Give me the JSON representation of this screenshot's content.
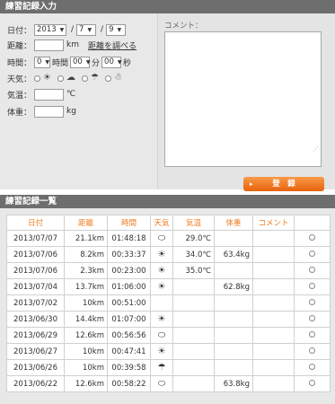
{
  "form": {
    "title": "練習記録入力",
    "date": {
      "label": "日付：",
      "year": "2013",
      "month": "7",
      "day": "9",
      "sep": "/"
    },
    "distance": {
      "label": "距離：",
      "value": "",
      "unit": "km",
      "lookup_link": "距離を調べる"
    },
    "time": {
      "label": "時間：",
      "hours": "0",
      "hours_unit": "時間",
      "minutes": "00",
      "minutes_unit": "分",
      "seconds": "00",
      "seconds_unit": "秒"
    },
    "weather": {
      "label": "天気：",
      "options": [
        "sunny-icon",
        "cloudy-icon",
        "rain-icon",
        "snowman-icon"
      ],
      "glyphs": [
        "☀",
        "☁",
        "☂",
        "☃"
      ]
    },
    "temperature": {
      "label": "気温：",
      "value": "",
      "unit": "℃"
    },
    "weight": {
      "label": "体重：",
      "value": "",
      "unit": "kg"
    },
    "comment": {
      "label": "コメント：",
      "value": ""
    },
    "submit_label": "登　録",
    "select_arrow": "▼",
    "grip": "⋰",
    "bullet": "▸"
  },
  "list": {
    "title": "練習記録一覧",
    "columns": [
      "日付",
      "距離",
      "時間",
      "天気",
      "気温",
      "体重",
      "コメント"
    ],
    "rows": [
      {
        "date": "2013/07/07",
        "distance": "21.1km",
        "time": "01:48:18",
        "weather": "cloudy",
        "glyph": "⬭",
        "temp": "29.0℃",
        "weight": "",
        "comment": ""
      },
      {
        "date": "2013/07/06",
        "distance": "8.2km",
        "time": "00:33:37",
        "weather": "sunny",
        "glyph": "☀",
        "temp": "34.0℃",
        "weight": "63.4kg",
        "comment": ""
      },
      {
        "date": "2013/07/06",
        "distance": "2.3km",
        "time": "00:23:00",
        "weather": "sunny",
        "glyph": "☀",
        "temp": "35.0℃",
        "weight": "",
        "comment": ""
      },
      {
        "date": "2013/07/04",
        "distance": "13.7km",
        "time": "01:06:00",
        "weather": "sunny",
        "glyph": "☀",
        "temp": "",
        "weight": "62.8kg",
        "comment": ""
      },
      {
        "date": "2013/07/02",
        "distance": "10km",
        "time": "00:51:00",
        "weather": "",
        "glyph": "",
        "temp": "",
        "weight": "",
        "comment": ""
      },
      {
        "date": "2013/06/30",
        "distance": "14.4km",
        "time": "01:07:00",
        "weather": "sunny",
        "glyph": "☀",
        "temp": "",
        "weight": "",
        "comment": ""
      },
      {
        "date": "2013/06/29",
        "distance": "12.6km",
        "time": "00:56:56",
        "weather": "cloudy",
        "glyph": "⬭",
        "temp": "",
        "weight": "",
        "comment": ""
      },
      {
        "date": "2013/06/27",
        "distance": "10km",
        "time": "00:47:41",
        "weather": "sunny",
        "glyph": "☀",
        "temp": "",
        "weight": "",
        "comment": ""
      },
      {
        "date": "2013/06/26",
        "distance": "10km",
        "time": "00:39:58",
        "weather": "rain",
        "glyph": "☂",
        "temp": "",
        "weight": "",
        "comment": ""
      },
      {
        "date": "2013/06/22",
        "distance": "12.6km",
        "time": "00:58:22",
        "weather": "cloudy",
        "glyph": "⬭",
        "temp": "",
        "weight": "63.8kg",
        "comment": ""
      }
    ]
  },
  "colors": {
    "header_bg": "#6e6e6e",
    "accent": "#f07b1e",
    "panel_bg": "#e8e8e8"
  }
}
